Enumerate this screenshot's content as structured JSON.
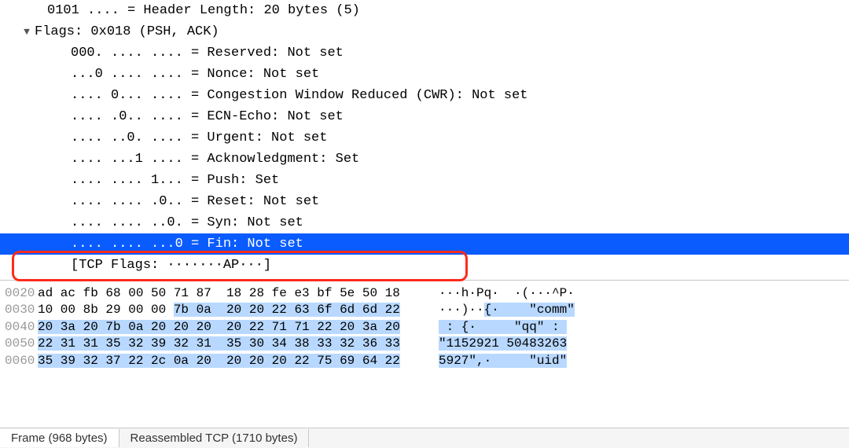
{
  "tree": {
    "header_length": "0101 .... = Header Length: 20 bytes (5)",
    "flags_header": "Flags: 0x018 (PSH, ACK)",
    "reserved": "000. .... .... = Reserved: Not set",
    "nonce": "...0 .... .... = Nonce: Not set",
    "cwr": ".... 0... .... = Congestion Window Reduced (CWR): Not set",
    "ecn": ".... .0.. .... = ECN-Echo: Not set",
    "urgent": ".... ..0. .... = Urgent: Not set",
    "ack": ".... ...1 .... = Acknowledgment: Set",
    "push": ".... .... 1... = Push: Set",
    "reset": ".... .... .0.. = Reset: Not set",
    "syn": ".... .... ..0. = Syn: Not set",
    "fin": ".... .... ...0 = Fin: Not set",
    "tcp_flags": "[TCP Flags: ·······AP···]"
  },
  "hex": {
    "rows": [
      {
        "offset": "0020",
        "b1": "ad ac fb 68 00 50 71 87 ",
        "b2": " 18 28 fe e3 bf 5e 50 18",
        "a1": "···h·Pq· ",
        "a2": " ·(···^P·"
      },
      {
        "offset": "0030",
        "b1_plain": "10 00 8b 29 00 00 ",
        "b1_hl": "7b 0a ",
        "b2_hl": " 20 20 22 63 6f 6d 6d 22",
        "a1_plain": "···)··",
        "a1_hl": "{· ",
        "a2_hl": "   \"comm\""
      },
      {
        "offset": "0040",
        "b1_hl": "20 3a 20 7b 0a 20 20 20 ",
        "b2_hl": " 20 22 71 71 22 20 3a 20",
        "a1_hl": " : {·    ",
        "a2_hl": " \"qq\" : "
      },
      {
        "offset": "0050",
        "b1_hl": "22 31 31 35 32 39 32 31 ",
        "b2_hl": " 35 30 34 38 33 32 36 33",
        "a1_hl": "\"1152921 ",
        "a2_hl": "50483263"
      },
      {
        "offset": "0060",
        "b1_hl": "35 39 32 37 22 2c 0a 20 ",
        "b2_hl": " 20 20 20 22 75 69 64 22",
        "a1_hl": "5927\",·  ",
        "a2_hl": "   \"uid\""
      }
    ]
  },
  "tabs": {
    "frame": "Frame (968 bytes)",
    "reassembled": "Reassembled TCP (1710 bytes)"
  }
}
